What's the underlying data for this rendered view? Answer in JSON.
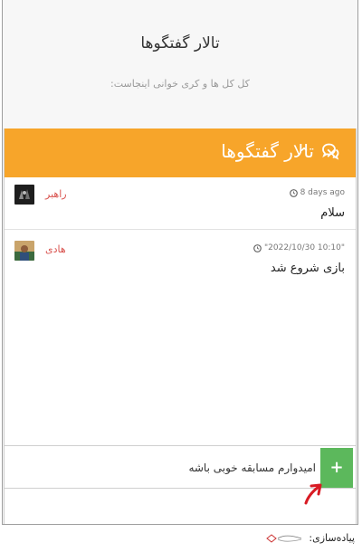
{
  "page": {
    "title": "تالار گفتگوها",
    "subtitle": "کل کل ها و کری خوانی اینجاست:"
  },
  "chat": {
    "title": "تالار گفتگوها",
    "icons": {
      "header": "comments-icon",
      "close": "close-icon",
      "collapse": "chevron-up-icon",
      "time": "clock-icon"
    },
    "close_glyph": "×",
    "collapse_glyph": "⌃",
    "messages": [
      {
        "username": "راهبر",
        "time": "8 days ago",
        "text": "سلام"
      },
      {
        "username": "هادی",
        "time": "\"2022/10/30 10:10\"",
        "text": "بازی شروع شد"
      }
    ],
    "composer": {
      "value": "امیدوارم مسابقه خوبی باشه",
      "send_glyph": "+"
    }
  },
  "footer": {
    "label": "پیاده‌سازی:"
  },
  "colors": {
    "header": "#f7a52a",
    "send": "#5cb85c",
    "username": "#d9534f",
    "arrow": "#d81b24"
  }
}
